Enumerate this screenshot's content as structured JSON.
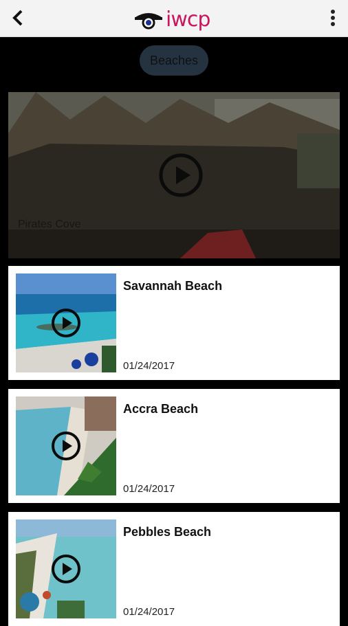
{
  "header": {
    "logo_text": "iwcp",
    "back_icon": "chevron-left-icon",
    "menu_icon": "kebab-menu-icon"
  },
  "filter": {
    "label": "Beaches"
  },
  "featured": {
    "title": "Pirates Cove"
  },
  "videos": [
    {
      "name": "Savannah Beach",
      "date": "01/24/2017"
    },
    {
      "name": "Accra Beach",
      "date": "01/24/2017"
    },
    {
      "name": "Pebbles Beach",
      "date": "01/24/2017"
    }
  ],
  "colors": {
    "brand": "#c9165f",
    "pill": "#253340",
    "topbar": "#f3f3f3"
  }
}
